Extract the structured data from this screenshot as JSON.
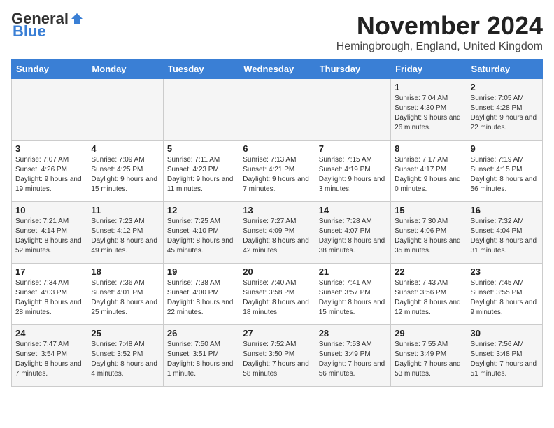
{
  "header": {
    "logo_general": "General",
    "logo_blue": "Blue",
    "month_title": "November 2024",
    "location": "Hemingbrough, England, United Kingdom"
  },
  "days_of_week": [
    "Sunday",
    "Monday",
    "Tuesday",
    "Wednesday",
    "Thursday",
    "Friday",
    "Saturday"
  ],
  "weeks": [
    [
      {
        "day": "",
        "info": ""
      },
      {
        "day": "",
        "info": ""
      },
      {
        "day": "",
        "info": ""
      },
      {
        "day": "",
        "info": ""
      },
      {
        "day": "",
        "info": ""
      },
      {
        "day": "1",
        "info": "Sunrise: 7:04 AM\nSunset: 4:30 PM\nDaylight: 9 hours and 26 minutes."
      },
      {
        "day": "2",
        "info": "Sunrise: 7:05 AM\nSunset: 4:28 PM\nDaylight: 9 hours and 22 minutes."
      }
    ],
    [
      {
        "day": "3",
        "info": "Sunrise: 7:07 AM\nSunset: 4:26 PM\nDaylight: 9 hours and 19 minutes."
      },
      {
        "day": "4",
        "info": "Sunrise: 7:09 AM\nSunset: 4:25 PM\nDaylight: 9 hours and 15 minutes."
      },
      {
        "day": "5",
        "info": "Sunrise: 7:11 AM\nSunset: 4:23 PM\nDaylight: 9 hours and 11 minutes."
      },
      {
        "day": "6",
        "info": "Sunrise: 7:13 AM\nSunset: 4:21 PM\nDaylight: 9 hours and 7 minutes."
      },
      {
        "day": "7",
        "info": "Sunrise: 7:15 AM\nSunset: 4:19 PM\nDaylight: 9 hours and 3 minutes."
      },
      {
        "day": "8",
        "info": "Sunrise: 7:17 AM\nSunset: 4:17 PM\nDaylight: 9 hours and 0 minutes."
      },
      {
        "day": "9",
        "info": "Sunrise: 7:19 AM\nSunset: 4:15 PM\nDaylight: 8 hours and 56 minutes."
      }
    ],
    [
      {
        "day": "10",
        "info": "Sunrise: 7:21 AM\nSunset: 4:14 PM\nDaylight: 8 hours and 52 minutes."
      },
      {
        "day": "11",
        "info": "Sunrise: 7:23 AM\nSunset: 4:12 PM\nDaylight: 8 hours and 49 minutes."
      },
      {
        "day": "12",
        "info": "Sunrise: 7:25 AM\nSunset: 4:10 PM\nDaylight: 8 hours and 45 minutes."
      },
      {
        "day": "13",
        "info": "Sunrise: 7:27 AM\nSunset: 4:09 PM\nDaylight: 8 hours and 42 minutes."
      },
      {
        "day": "14",
        "info": "Sunrise: 7:28 AM\nSunset: 4:07 PM\nDaylight: 8 hours and 38 minutes."
      },
      {
        "day": "15",
        "info": "Sunrise: 7:30 AM\nSunset: 4:06 PM\nDaylight: 8 hours and 35 minutes."
      },
      {
        "day": "16",
        "info": "Sunrise: 7:32 AM\nSunset: 4:04 PM\nDaylight: 8 hours and 31 minutes."
      }
    ],
    [
      {
        "day": "17",
        "info": "Sunrise: 7:34 AM\nSunset: 4:03 PM\nDaylight: 8 hours and 28 minutes."
      },
      {
        "day": "18",
        "info": "Sunrise: 7:36 AM\nSunset: 4:01 PM\nDaylight: 8 hours and 25 minutes."
      },
      {
        "day": "19",
        "info": "Sunrise: 7:38 AM\nSunset: 4:00 PM\nDaylight: 8 hours and 22 minutes."
      },
      {
        "day": "20",
        "info": "Sunrise: 7:40 AM\nSunset: 3:58 PM\nDaylight: 8 hours and 18 minutes."
      },
      {
        "day": "21",
        "info": "Sunrise: 7:41 AM\nSunset: 3:57 PM\nDaylight: 8 hours and 15 minutes."
      },
      {
        "day": "22",
        "info": "Sunrise: 7:43 AM\nSunset: 3:56 PM\nDaylight: 8 hours and 12 minutes."
      },
      {
        "day": "23",
        "info": "Sunrise: 7:45 AM\nSunset: 3:55 PM\nDaylight: 8 hours and 9 minutes."
      }
    ],
    [
      {
        "day": "24",
        "info": "Sunrise: 7:47 AM\nSunset: 3:54 PM\nDaylight: 8 hours and 7 minutes."
      },
      {
        "day": "25",
        "info": "Sunrise: 7:48 AM\nSunset: 3:52 PM\nDaylight: 8 hours and 4 minutes."
      },
      {
        "day": "26",
        "info": "Sunrise: 7:50 AM\nSunset: 3:51 PM\nDaylight: 8 hours and 1 minute."
      },
      {
        "day": "27",
        "info": "Sunrise: 7:52 AM\nSunset: 3:50 PM\nDaylight: 7 hours and 58 minutes."
      },
      {
        "day": "28",
        "info": "Sunrise: 7:53 AM\nSunset: 3:49 PM\nDaylight: 7 hours and 56 minutes."
      },
      {
        "day": "29",
        "info": "Sunrise: 7:55 AM\nSunset: 3:49 PM\nDaylight: 7 hours and 53 minutes."
      },
      {
        "day": "30",
        "info": "Sunrise: 7:56 AM\nSunset: 3:48 PM\nDaylight: 7 hours and 51 minutes."
      }
    ]
  ]
}
